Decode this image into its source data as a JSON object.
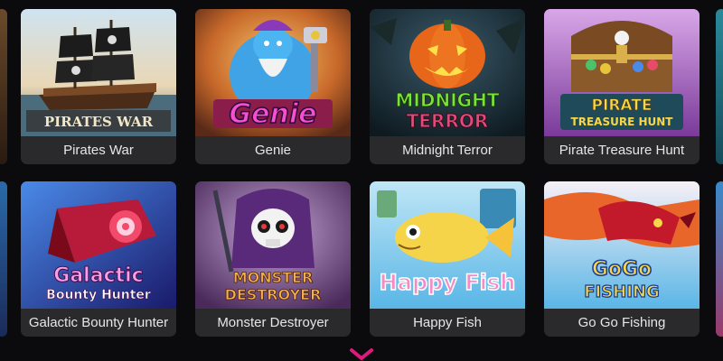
{
  "games": [
    {
      "title": "Pirates War",
      "logo": "PIRATES WAR",
      "icon": "pirate-ship-icon"
    },
    {
      "title": "Genie",
      "logo": "Genie",
      "icon": "genie-icon"
    },
    {
      "title": "Midnight Terror",
      "logo_line1": "MIDNIGHT",
      "logo_line2": "TERROR",
      "icon": "pumpkin-icon"
    },
    {
      "title": "Pirate Treasure Hunt",
      "logo_line1": "PIRATE",
      "logo_line2": "TREASURE HUNT",
      "icon": "treasure-chest-icon"
    },
    {
      "title": "Galactic Bounty Hunter",
      "logo_line1": "Galactic",
      "logo_line2": "Bounty Hunter",
      "icon": "spaceship-icon"
    },
    {
      "title": "Monster Destroyer",
      "logo_line1": "MONSTER",
      "logo_line2": "DESTROYER",
      "icon": "skull-reaper-icon"
    },
    {
      "title": "Happy Fish",
      "logo": "Happy Fish",
      "icon": "fish-icon"
    },
    {
      "title": "Go Go Fishing",
      "logo_line1": "GoGo",
      "logo_line2": "FISHING",
      "icon": "dragon-icon"
    }
  ],
  "accent_color": "#e0197d",
  "scroll_icon": "chevron-down-icon"
}
